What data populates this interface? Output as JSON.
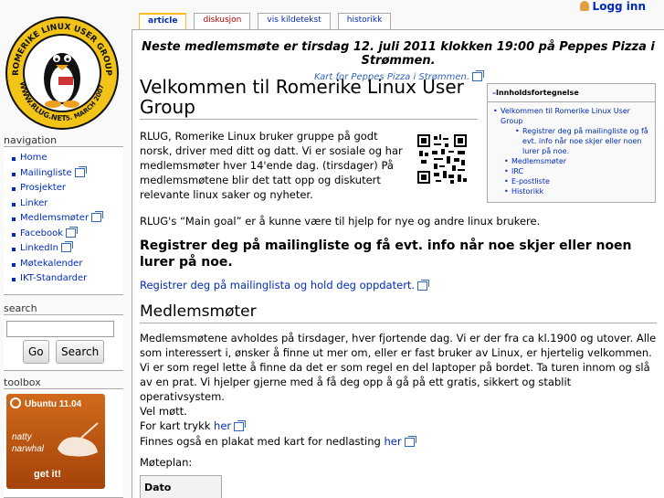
{
  "personal": {
    "login": "Logg inn"
  },
  "tabs": [
    {
      "label": "article",
      "selected": true
    },
    {
      "label": "diskusjon",
      "red": true
    },
    {
      "label": "vis kildetekst"
    },
    {
      "label": "historikk"
    }
  ],
  "logo": {
    "ring_text": "ROMERIKE LINUX USER GROUP",
    "bottom_text": "WWW.RLUG.NET",
    "date_text": "5. MARCH 2007"
  },
  "navigation": {
    "title": "navigation",
    "items": [
      {
        "label": "Home",
        "external": false
      },
      {
        "label": "Mailingliste",
        "external": true
      },
      {
        "label": "Prosjekter",
        "external": false
      },
      {
        "label": "Linker",
        "external": false
      },
      {
        "label": "Medlemsmøter",
        "external": true
      },
      {
        "label": "Facebook",
        "external": true
      },
      {
        "label": "LinkedIn",
        "external": true
      },
      {
        "label": "Møtekalender",
        "external": false
      },
      {
        "label": "IKT-Standarder",
        "external": false
      }
    ]
  },
  "search": {
    "title": "search",
    "value": "",
    "go": "Go",
    "search": "Search"
  },
  "toolbox": {
    "title": "toolbox",
    "banner_title": "Ubuntu 11.04",
    "banner_line1": "natty",
    "banner_line2": "narwhal",
    "banner_cta": "get it!"
  },
  "notice": {
    "main": "Neste medlemsmøte er tirsdag 12. juli 2011 klokken 19:00 på Peppes Pizza i Strømmen.",
    "link": "Kart for Peppes Pizza i Strømmen."
  },
  "page": {
    "title": "Velkommen til Romerike Linux User Group",
    "intro": "RLUG, Romerike Linux bruker gruppe på godt norsk, driver med ditt og datt. Vi er sosiale og har medlemsmøter hver 14'ende dag. (tirsdager) På medlemsmøtene blir det tatt opp og diskutert relevante linux saker og nyheter.",
    "main_goal": "RLUG's “Main goal” er å kunne være til hjelp for nye og andre linux brukere.",
    "register_heading": "Registrer deg på mailingliste og få evt. info når noe skjer eller noen lurer på noe.",
    "register_link": "Registrer deg på mailinglista og hold deg oppdatert.",
    "meetings_heading": "Medlemsmøter",
    "meetings_text": "Medlemsmøtene avholdes på tirsdager, hver fjortende dag. Vi er der fra ca kl.1900 og utover. Alle som interessert i, ønsker å finne ut mer om, eller er fast bruker av Linux, er hjertelig velkommen. Vi er som regel lette å finne da det er som regel en del laptoper på bordet. Ta turen innom og slå av en prat. Vi hjelper gjerne med å få deg opp å gå på ett gratis, sikkert og stablit operativsystem.",
    "welcome": "Vel møtt.",
    "map_prefix": "For kart trykk ",
    "map_link": "her",
    "poster_prefix": "Finnes også en plakat med kart for nedlasting ",
    "poster_link": "her",
    "plan_label": "Møteplan:",
    "table_header": "Dato"
  },
  "toc": {
    "title": "Innholdsfortegnelse",
    "toggle": "–",
    "items": [
      {
        "label": "Velkommen til Romerike Linux User Group",
        "level": 1
      },
      {
        "label": "Registrer deg på mailingliste og få evt. info når noe skjer eller noen lurer på noe.",
        "level": 3
      },
      {
        "label": "Medlemsmøter",
        "level": 2
      },
      {
        "label": "IRC",
        "level": 2
      },
      {
        "label": "E-postliste",
        "level": 2
      },
      {
        "label": "Historikk",
        "level": 2
      }
    ]
  },
  "colors": {
    "link": "#002bb8",
    "tab_selected": "#fabd23",
    "red_link": "#ba0000"
  }
}
